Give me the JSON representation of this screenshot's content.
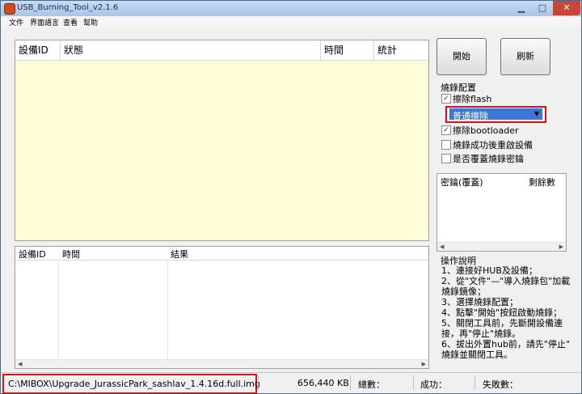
{
  "window": {
    "title": "USB_Burning_Tool_v2.1.6"
  },
  "menu": [
    "文件",
    "界面語言",
    "查看",
    "幫助"
  ],
  "main_table": {
    "columns": [
      "設備ID",
      "狀態",
      "時間",
      "統計"
    ]
  },
  "buttons": {
    "start": "開始",
    "refresh": "刷新"
  },
  "config": {
    "label": "燒錄配置",
    "erase_flash": {
      "label": "擦除flash",
      "checked": true
    },
    "erase_mode": "普通擦除",
    "erase_bootloader": {
      "label": "擦除bootloader",
      "checked": true
    },
    "reset_after": {
      "label": "燒錄成功後重啟設備",
      "checked": false
    },
    "overwrite_key": {
      "label": "是否覆蓋燒錄密鑰",
      "checked": false
    }
  },
  "key_table": {
    "columns": [
      "密鑰(覆蓋)",
      "剩餘數"
    ]
  },
  "instructions": {
    "label": "操作說明",
    "lines": [
      "1、連接好HUB及設備；",
      "2、從\"文件\"—\"導入燒錄包\"加載",
      "燒錄鏡像；",
      "3、選擇燒錄配置；",
      "4、點擊\"開始\"按鈕啟動燒錄；",
      "5、關閉工具前，先斷開設備連",
      "接，再\"停止\"燒錄。",
      "6、拔出外置hub前，請先\"停止\"",
      "燒錄並關閉工具。"
    ]
  },
  "log_table": {
    "columns": [
      "設備ID",
      "時間",
      "結果"
    ]
  },
  "status": {
    "path": "C:\\MIBOX\\Upgrade_JurassicPark_sashlav_1.4.16d.full.img",
    "size": "656,440 KB",
    "total": "總數：",
    "success": "成功：",
    "fail": "失敗數："
  },
  "colors": {
    "accent_red": "#e01010",
    "list_bg": "#fefdd8",
    "selection": "#3a78d6"
  }
}
